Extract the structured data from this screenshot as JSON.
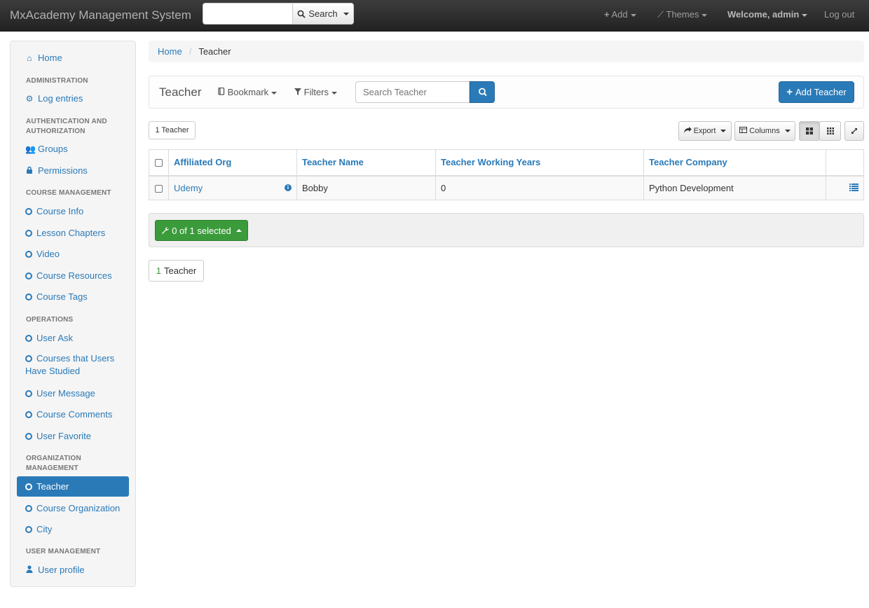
{
  "navbar": {
    "brand": "MxAcademy Management System",
    "search_value": "",
    "search_button": "Search",
    "add": "Add",
    "themes": "Themes",
    "welcome": "Welcome, admin",
    "logout": "Log out"
  },
  "sidebar": {
    "home": "Home",
    "headers": {
      "administration": "ADMINISTRATION",
      "auth": "AUTHENTICATION AND AUTHORIZATION",
      "course_mgmt": "COURSE MANAGEMENT",
      "operations": "OPERATIONS",
      "org_mgmt": "ORGANIZATION MANAGEMENT",
      "user_mgmt": "USER MANAGEMENT"
    },
    "items": {
      "log_entries": "Log entries",
      "groups": "Groups",
      "permissions": "Permissions",
      "course_info": "Course Info",
      "lesson_chapters": "Lesson Chapters",
      "video": "Video",
      "course_resources": "Course Resources",
      "course_tags": "Course Tags",
      "user_ask": "User Ask",
      "courses_studied": "Courses that Users Have Studied",
      "user_message": "User Message",
      "course_comments": "Course Comments",
      "user_favorite": "User Favorite",
      "teacher": "Teacher",
      "course_organization": "Course Organization",
      "city": "City",
      "user_profile": "User profile"
    },
    "active_item": "Teacher"
  },
  "breadcrumb": {
    "home": "Home",
    "current": "Teacher"
  },
  "toolbar": {
    "title": "Teacher",
    "bookmark": "Bookmark",
    "filters": "Filters",
    "search_placeholder": "Search Teacher",
    "add_button": "Add Teacher"
  },
  "subtoolbar": {
    "count": "1 Teacher",
    "export": "Export",
    "columns": "Columns"
  },
  "table": {
    "columns": [
      "Affiliated Org",
      "Teacher Name",
      "Teacher Working Years",
      "Teacher Company"
    ],
    "rows": [
      {
        "org": "Udemy",
        "name": "Bobby",
        "years": "0",
        "company": "Python Development"
      }
    ]
  },
  "actions": {
    "selected": "0 of 1 selected"
  },
  "footer": {
    "count_num": "1",
    "count_label": "Teacher"
  },
  "colors": {
    "primary": "#2a7ab8",
    "success": "#3b9b3b",
    "navbar": "#222222"
  }
}
